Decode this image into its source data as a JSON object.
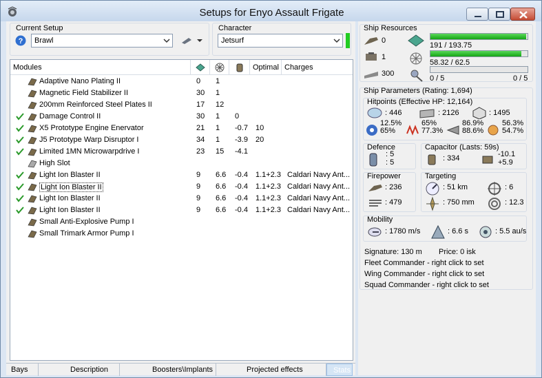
{
  "window": {
    "title": "Setups for Enyo Assault Frigate"
  },
  "setup": {
    "label": "Current Setup",
    "value": "Brawl"
  },
  "character": {
    "label": "Character",
    "value": "Jetsurf"
  },
  "modules": {
    "headers": [
      "Modules",
      "",
      "",
      "",
      "Optimal",
      "Charges"
    ],
    "rows": [
      {
        "name": "Adaptive Nano Plating II",
        "c1": "0",
        "c2": "1",
        "c3": "",
        "opt": "",
        "chg": "",
        "checked": false,
        "selected": false,
        "icon": "armor-plating-icon"
      },
      {
        "name": "Magnetic Field Stabilizer II",
        "c1": "30",
        "c2": "1",
        "c3": "",
        "opt": "",
        "chg": "",
        "checked": false,
        "selected": false,
        "icon": "damage-mod-icon"
      },
      {
        "name": "200mm Reinforced Steel Plates II",
        "c1": "17",
        "c2": "12",
        "c3": "",
        "opt": "",
        "chg": "",
        "checked": false,
        "selected": false,
        "icon": "armor-plate-icon"
      },
      {
        "name": "Damage Control II",
        "c1": "30",
        "c2": "1",
        "c3": "0",
        "opt": "",
        "chg": "",
        "checked": true,
        "selected": false,
        "icon": "damage-control-icon"
      },
      {
        "name": "X5 Prototype Engine Enervator",
        "c1": "21",
        "c2": "1",
        "c3": "-0.7",
        "opt": "10",
        "chg": "",
        "checked": true,
        "selected": false,
        "icon": "webifier-icon"
      },
      {
        "name": "J5 Prototype Warp Disruptor I",
        "c1": "34",
        "c2": "1",
        "c3": "-3.9",
        "opt": "20",
        "chg": "",
        "checked": true,
        "selected": false,
        "icon": "warp-disruptor-icon"
      },
      {
        "name": "Limited 1MN Microwarpdrive I",
        "c1": "23",
        "c2": "15",
        "c3": "-4.1",
        "opt": "",
        "chg": "",
        "checked": true,
        "selected": false,
        "icon": "microwarpdrive-icon"
      },
      {
        "name": "High Slot",
        "c1": "",
        "c2": "",
        "c3": "",
        "opt": "",
        "chg": "",
        "checked": false,
        "selected": false,
        "icon": "high-slot-icon"
      },
      {
        "name": "Light Ion Blaster II",
        "c1": "9",
        "c2": "6.6",
        "c3": "-0.4",
        "opt": "1.1+2.3",
        "chg": "Caldari Navy Ant...",
        "checked": true,
        "selected": false,
        "icon": "blaster-icon"
      },
      {
        "name": "Light Ion Blaster II",
        "c1": "9",
        "c2": "6.6",
        "c3": "-0.4",
        "opt": "1.1+2.3",
        "chg": "Caldari Navy Ant...",
        "checked": true,
        "selected": true,
        "icon": "blaster-icon"
      },
      {
        "name": "Light Ion Blaster II",
        "c1": "9",
        "c2": "6.6",
        "c3": "-0.4",
        "opt": "1.1+2.3",
        "chg": "Caldari Navy Ant...",
        "checked": true,
        "selected": false,
        "icon": "blaster-icon"
      },
      {
        "name": "Light Ion Blaster II",
        "c1": "9",
        "c2": "6.6",
        "c3": "-0.4",
        "opt": "1.1+2.3",
        "chg": "Caldari Navy Ant...",
        "checked": true,
        "selected": false,
        "icon": "blaster-icon"
      },
      {
        "name": "Small Anti-Explosive Pump I",
        "c1": "",
        "c2": "",
        "c3": "",
        "opt": "",
        "chg": "",
        "checked": false,
        "selected": false,
        "icon": "rig-icon"
      },
      {
        "name": "Small Trimark Armor Pump I",
        "c1": "",
        "c2": "",
        "c3": "",
        "opt": "",
        "chg": "",
        "checked": false,
        "selected": false,
        "icon": "rig-icon"
      }
    ]
  },
  "tabs": [
    "Bays",
    "Description",
    "Boosters\\Implants",
    "Projected effects",
    "Stats"
  ],
  "resources": {
    "title": "Ship Resources",
    "turret_hardpoints": "0",
    "launcher_hardpoints": "1",
    "drone_bay": "300",
    "cpu": "191 / 193.75",
    "cpu_fraction": 0.986,
    "powergrid": "58.32 / 62.5",
    "powergrid_fraction": 0.933,
    "calibration_used": "0 / 5",
    "calibration_total": "0 / 5",
    "calibration_fraction": 0.0
  },
  "params": {
    "title": "Ship Parameters (Rating: 1,694)",
    "hitpoints_title": "Hitpoints (Effective HP: 12,164)",
    "shield_hp": ": 446",
    "armor_hp": ": 2126",
    "hull_hp": ": 1495",
    "em": [
      "12.5%",
      "65%"
    ],
    "thermal": [
      "65%",
      "77.3%"
    ],
    "kinetic": [
      "86.9%",
      "88.6%"
    ],
    "explosive": [
      "56.3%",
      "54.7%"
    ],
    "defence_title": "Defence",
    "defence_1": ": 5",
    "defence_2": ": 5",
    "capacitor_title": "Capacitor (Lasts: 59s)",
    "capacitor_amount": ": 334",
    "capacitor_delta": "-10.1",
    "capacitor_regen": "+5.9",
    "firepower_title": "Firepower",
    "firepower_1": ": 236",
    "firepower_2": ": 479",
    "targeting_title": "Targeting",
    "target_range": ": 51 km",
    "max_targets": ": 6",
    "scan_range": ": 750 mm",
    "sensor_strength": ": 12.3",
    "mobility_title": "Mobility",
    "speed": ": 1780 m/s",
    "align_time": ": 6.6 s",
    "warp_speed": ": 5.5 au/s",
    "signature": "Signature: 130 m",
    "price": "Price: 0 isk",
    "fleet_commander": "Fleet Commander - right click to set",
    "wing_commander": "Wing Commander - right click to set",
    "squad_commander": "Squad Commander - right click to set"
  },
  "colors": {
    "bar_fill": "#2fb52f",
    "status_green": "#22cc22",
    "check": "#2a9a2a"
  }
}
